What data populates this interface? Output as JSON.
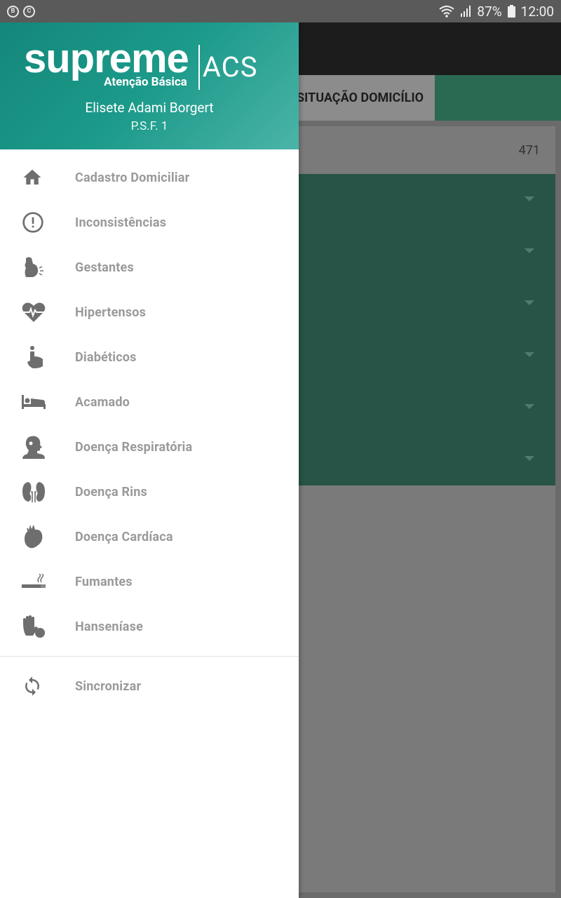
{
  "status_bar": {
    "left_icons": [
      "B",
      "C"
    ],
    "battery_percent": "87%",
    "time": "12:00"
  },
  "background_app": {
    "active_tab_label": "SITUAÇÃO DOMICÍLIO",
    "count": "471"
  },
  "drawer": {
    "brand": {
      "name": "supreme",
      "subtitle": "Atenção Básica",
      "product": "ACS"
    },
    "user": {
      "name": "Elisete Adami Borgert",
      "unit": "P.S.F. 1"
    },
    "menu_items": [
      {
        "label": "Cadastro Domiciliar",
        "icon": "home-icon"
      },
      {
        "label": "Inconsistências",
        "icon": "alert-circle-icon"
      },
      {
        "label": "Gestantes",
        "icon": "pregnant-icon"
      },
      {
        "label": "Hipertensos",
        "icon": "heartbeat-icon"
      },
      {
        "label": "Diabéticos",
        "icon": "finger-prick-icon"
      },
      {
        "label": "Acamado",
        "icon": "bed-icon"
      },
      {
        "label": "Doença Respiratória",
        "icon": "head-profile-icon"
      },
      {
        "label": "Doença Rins",
        "icon": "kidney-icon"
      },
      {
        "label": "Doença Cardíaca",
        "icon": "heart-organ-icon"
      },
      {
        "label": "Fumantes",
        "icon": "cigarette-icon"
      },
      {
        "label": "Hanseníase",
        "icon": "hand-ball-icon"
      }
    ],
    "sync_label": "Sincronizar",
    "sync_icon": "sync-icon"
  },
  "colors": {
    "header_start": "#13877a",
    "header_end": "#4bb4a8",
    "icon_gray": "#6e6e6e",
    "label_gray": "#9a9a9a"
  }
}
